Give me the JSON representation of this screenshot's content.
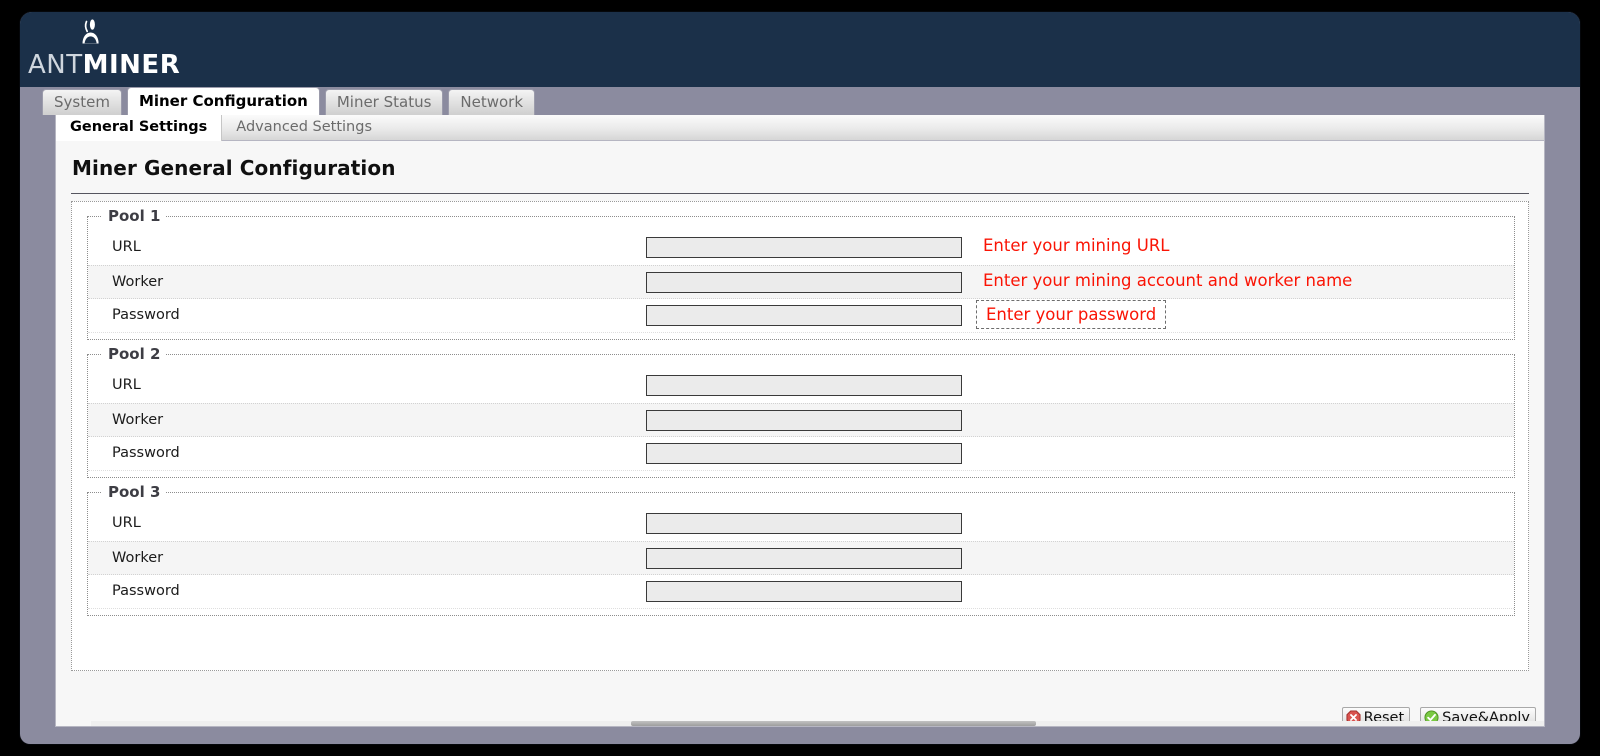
{
  "window": {
    "frame_color": "#8b8b9f",
    "header_color": "#1b3049"
  },
  "brand": {
    "name_light": "ANT",
    "name_bold": "MINER",
    "icon": "ant-icon"
  },
  "tabs": [
    {
      "label": "System",
      "active": false
    },
    {
      "label": "Miner Configuration",
      "active": true
    },
    {
      "label": "Miner Status",
      "active": false
    },
    {
      "label": "Network",
      "active": false
    }
  ],
  "subtabs": [
    {
      "label": "General Settings",
      "active": true
    },
    {
      "label": "Advanced Settings",
      "active": false
    }
  ],
  "page": {
    "title": "Miner General Configuration"
  },
  "pools": [
    {
      "legend": "Pool 1",
      "rows": [
        {
          "label": "URL",
          "value": "",
          "placeholder": "",
          "hint": "Enter your mining URL",
          "hint_boxed": false
        },
        {
          "label": "Worker",
          "value": "",
          "placeholder": "",
          "hint": "Enter your mining account and worker name",
          "hint_boxed": false
        },
        {
          "label": "Password",
          "value": "",
          "placeholder": "",
          "hint": "Enter your password",
          "hint_boxed": true
        }
      ]
    },
    {
      "legend": "Pool 2",
      "rows": [
        {
          "label": "URL",
          "value": "",
          "placeholder": "",
          "hint": "",
          "hint_boxed": false
        },
        {
          "label": "Worker",
          "value": "",
          "placeholder": "",
          "hint": "",
          "hint_boxed": false
        },
        {
          "label": "Password",
          "value": "",
          "placeholder": "",
          "hint": "",
          "hint_boxed": false
        }
      ]
    },
    {
      "legend": "Pool 3",
      "rows": [
        {
          "label": "URL",
          "value": "",
          "placeholder": "",
          "hint": "",
          "hint_boxed": false
        },
        {
          "label": "Worker",
          "value": "",
          "placeholder": "",
          "hint": "",
          "hint_boxed": false
        },
        {
          "label": "Password",
          "value": "",
          "placeholder": "",
          "hint": "",
          "hint_boxed": false
        }
      ]
    }
  ],
  "footer": {
    "reset_label": "Reset",
    "reset_icon": "red-octagon-x-icon",
    "save_label": "Save&Apply",
    "save_icon": "green-circle-check-icon"
  },
  "colors": {
    "hint_red": "#fa1405",
    "header_navy": "#1b3049",
    "frame_purple": "#8b8b9f",
    "input_fill": "#ebebeb"
  }
}
